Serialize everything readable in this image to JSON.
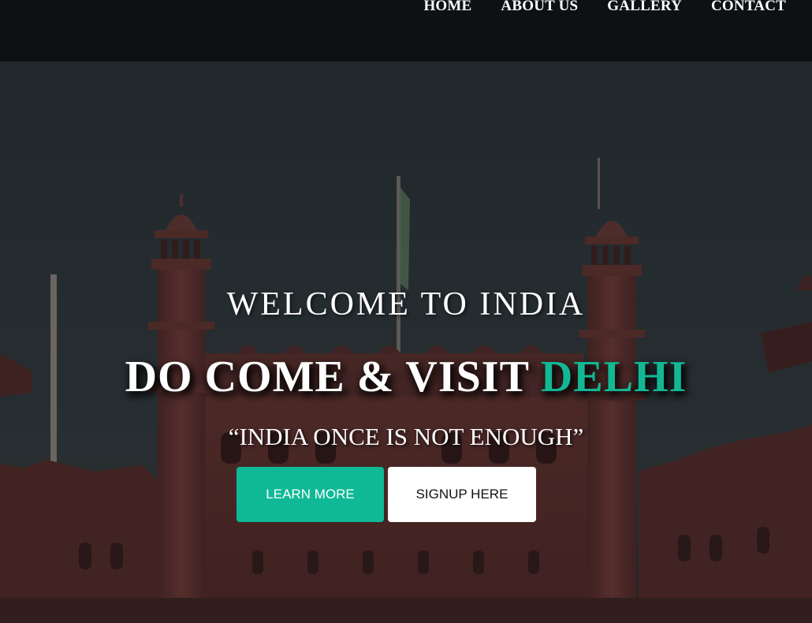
{
  "nav": {
    "items": [
      {
        "label": "HOME"
      },
      {
        "label": "ABOUT US"
      },
      {
        "label": "GALLERY"
      },
      {
        "label": "CONTACT"
      }
    ]
  },
  "hero": {
    "welcome": "WELCOME TO INDIA",
    "headline_main": "DO COME & VISIT ",
    "headline_accent": "DELHI",
    "tagline": "“INDIA ONCE IS NOT ENOUGH”",
    "learn_more_label": "LEARN MORE",
    "signup_label": "SIGNUP HERE"
  },
  "colors": {
    "accent": "#12b894",
    "navbar": "#0d1114",
    "signup_bg": "#ffffff"
  }
}
